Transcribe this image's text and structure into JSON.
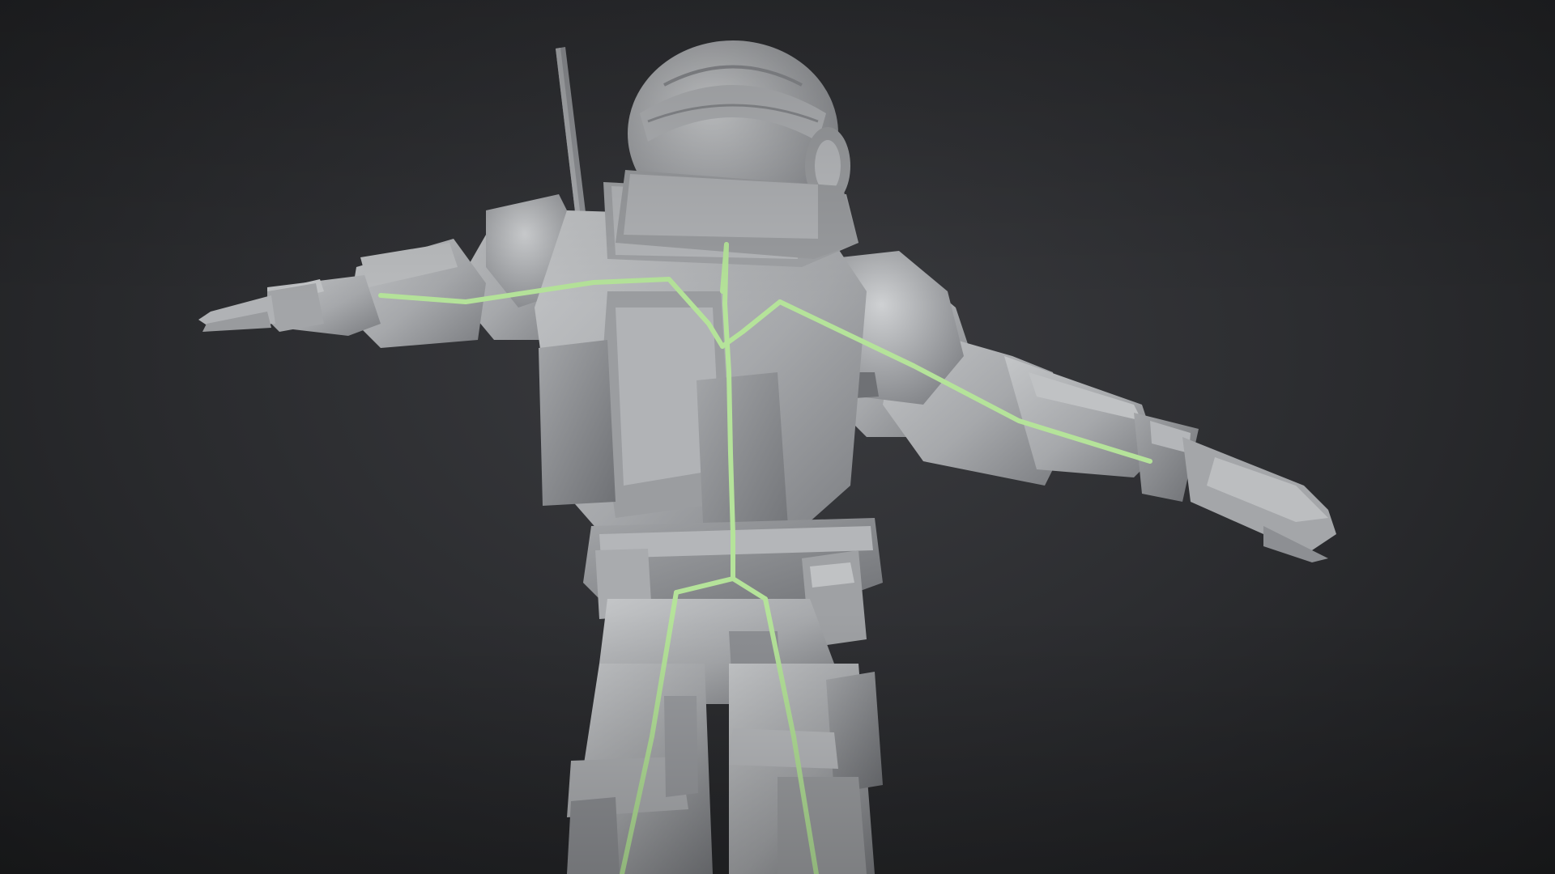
{
  "scene": {
    "background_color": "#2a2b2e",
    "model_color": "#a9abad",
    "model_shadow_color": "#7c7e81",
    "model_highlight_color": "#c8cacc",
    "skeleton_color": "#b5e39a"
  }
}
